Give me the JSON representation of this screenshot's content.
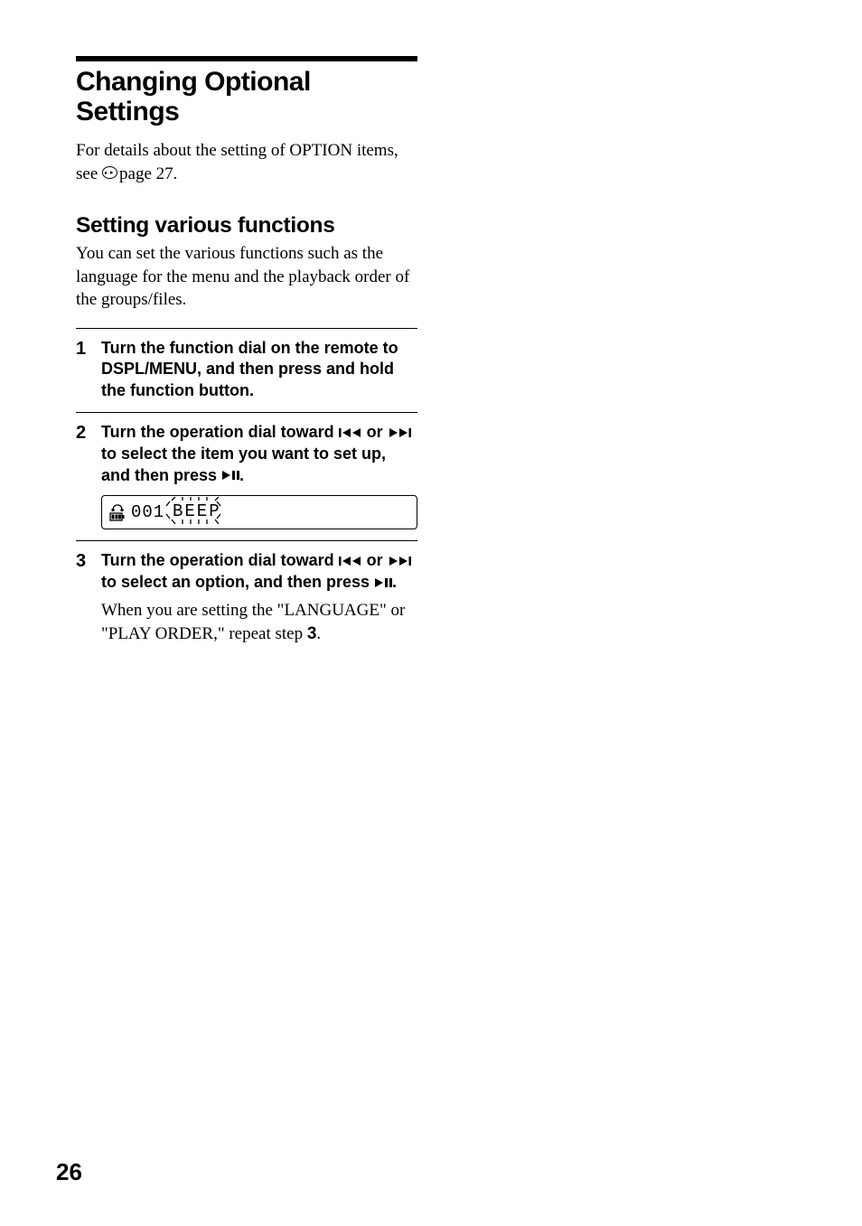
{
  "title": "Changing Optional Settings",
  "intro": {
    "line1": "For details about the setting of OPTION items, see ",
    "page_ref": "page 27."
  },
  "section": {
    "subtitle": "Setting various functions",
    "intro": "You can set the various functions such as the language for the menu and the playback order of the groups/files."
  },
  "steps": [
    {
      "number": "1",
      "instruction": "Turn the function dial on the remote to DSPL/MENU, and then press and hold the function button."
    },
    {
      "number": "2",
      "instruction_parts": {
        "a": "Turn the operation dial toward ",
        "b": " or ",
        "c": " to select the item you want to set up, and then press ",
        "d": "."
      },
      "display": {
        "track": "001",
        "label": "BEEP"
      }
    },
    {
      "number": "3",
      "instruction_parts": {
        "a": "Turn the operation dial toward ",
        "b": " or ",
        "c": " to select an option, and then press ",
        "d": "."
      },
      "detail_parts": {
        "a": "When you are setting the \"LANGUAGE\" or \"PLAY ORDER,\" repeat step ",
        "b": "3",
        "c": "."
      }
    }
  ],
  "page_number": "26",
  "icons": {
    "prev": "prev-track-icon",
    "next": "next-track-icon",
    "play_pause": "play-pause-icon",
    "hand": "pointing-hand-icon"
  }
}
